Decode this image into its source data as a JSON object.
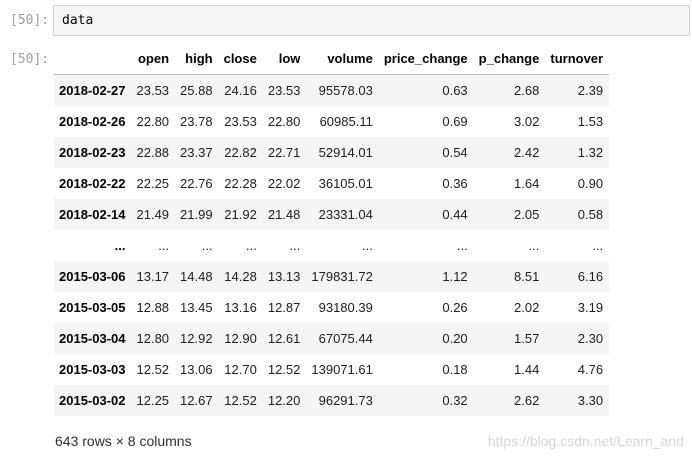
{
  "input_cell": {
    "prompt": "[50]:",
    "code": "data"
  },
  "output_cell": {
    "prompt": "[50]:"
  },
  "dataframe": {
    "columns": [
      "open",
      "high",
      "close",
      "low",
      "volume",
      "price_change",
      "p_change",
      "turnover"
    ],
    "rows": [
      {
        "index": "2018-02-27",
        "values": [
          "23.53",
          "25.88",
          "24.16",
          "23.53",
          "95578.03",
          "0.63",
          "2.68",
          "2.39"
        ]
      },
      {
        "index": "2018-02-26",
        "values": [
          "22.80",
          "23.78",
          "23.53",
          "22.80",
          "60985.11",
          "0.69",
          "3.02",
          "1.53"
        ]
      },
      {
        "index": "2018-02-23",
        "values": [
          "22.88",
          "23.37",
          "22.82",
          "22.71",
          "52914.01",
          "0.54",
          "2.42",
          "1.32"
        ]
      },
      {
        "index": "2018-02-22",
        "values": [
          "22.25",
          "22.76",
          "22.28",
          "22.02",
          "36105.01",
          "0.36",
          "1.64",
          "0.90"
        ]
      },
      {
        "index": "2018-02-14",
        "values": [
          "21.49",
          "21.99",
          "21.92",
          "21.48",
          "23331.04",
          "0.44",
          "2.05",
          "0.58"
        ]
      },
      {
        "index": "...",
        "values": [
          "...",
          "...",
          "...",
          "...",
          "...",
          "...",
          "...",
          "..."
        ]
      },
      {
        "index": "2015-03-06",
        "values": [
          "13.17",
          "14.48",
          "14.28",
          "13.13",
          "179831.72",
          "1.12",
          "8.51",
          "6.16"
        ]
      },
      {
        "index": "2015-03-05",
        "values": [
          "12.88",
          "13.45",
          "13.16",
          "12.87",
          "93180.39",
          "0.26",
          "2.02",
          "3.19"
        ]
      },
      {
        "index": "2015-03-04",
        "values": [
          "12.80",
          "12.92",
          "12.90",
          "12.61",
          "67075.44",
          "0.20",
          "1.57",
          "2.30"
        ]
      },
      {
        "index": "2015-03-03",
        "values": [
          "12.52",
          "13.06",
          "12.70",
          "12.52",
          "139071.61",
          "0.18",
          "1.44",
          "4.76"
        ]
      },
      {
        "index": "2015-03-02",
        "values": [
          "12.25",
          "12.67",
          "12.52",
          "12.20",
          "96291.73",
          "0.32",
          "2.62",
          "3.30"
        ]
      }
    ],
    "shape_text": "643 rows × 8 columns"
  },
  "watermark": "https://blog.csdn.net/Learn_and"
}
